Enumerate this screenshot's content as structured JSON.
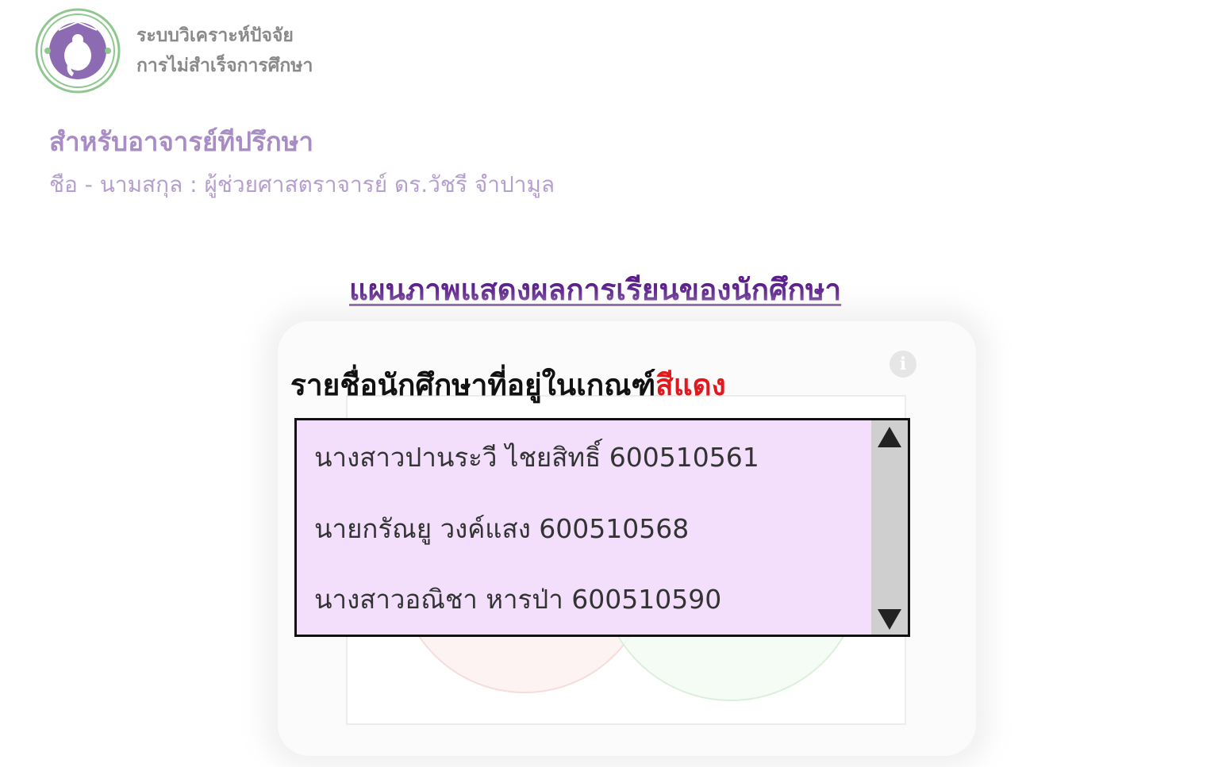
{
  "header": {
    "logo_icon": "cmu-elephant-seal-icon",
    "app_title_line1": "ระบบวิเคราะห์ปัจจัย",
    "app_title_line2": "การไม่สำเร็จการศึกษา"
  },
  "role": {
    "title": "สำหรับอาจารย์ทีปรึกษา",
    "advisor_line": "ชือ - นามสกุล : ผู้ช่วยศาสตราจารย์ ดร.วัชรี  จำปามูล"
  },
  "main": {
    "chart_link": "แผนภาพแสดงผลการเรียนของนักศึกษา",
    "list_title_prefix": "รายชื่อนักศึกษาที่อยู่ในเกณฑ์",
    "list_title_highlight": "สีแดง",
    "students": [
      "นางสาวปานระวี ไชยสิทธิ์ 600510561",
      "นายกรัณยู วงค์แสง 600510568",
      "นางสาวอณิชา หารป่า 600510590"
    ]
  },
  "colors": {
    "accent_purple": "#5a1f8a",
    "highlight_red": "#e0191e",
    "list_background": "#f3dffb"
  }
}
